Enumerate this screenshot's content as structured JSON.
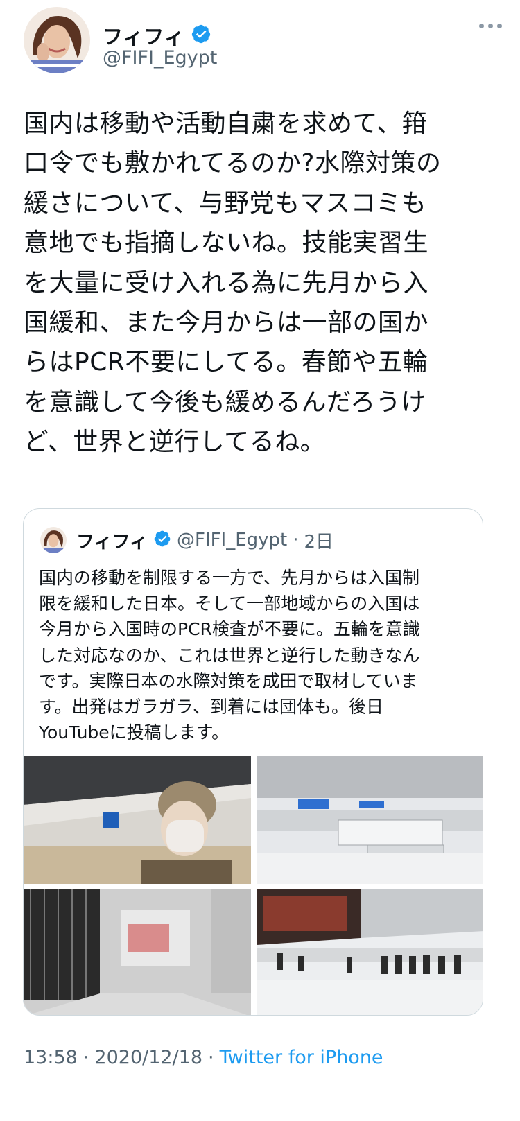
{
  "author": {
    "display_name": "フィフィ",
    "handle": "@FIFI_Egypt"
  },
  "tweet": {
    "text_lines": [
      "国内は移動や活動自粛を求めて、箝",
      "口令でも敷かれてるのか?水際対策の",
      "緩さについて、与野党もマスコミも",
      "意地でも指摘しないね。技能実習生",
      "を大量に受け入れる為に先月から入",
      "国緩和、また今月からは一部の国か",
      "らはPCR不要にしてる。春節や五輪",
      "を意識して今後も緩めるんだろうけ",
      "ど、世界と逆行してるね。"
    ]
  },
  "quoted_tweet": {
    "display_name": "フィフィ",
    "handle": "@FIFI_Egypt",
    "separator": "·",
    "age": "2日",
    "text_lines": [
      "国内の移動を制限する一方で、先月からは入国制",
      "限を緩和した日本。そして一部地域からの入国は",
      "今月から入国時のPCR検査が不要に。五輪を意識",
      "した対応なのか、これは世界と逆行した動きなん",
      "です。実際日本の水際対策を成田で取材していま",
      "す。出発はガラガラ、到着には団体も。後日",
      "YouTubeに投稿します。"
    ],
    "media": [
      "airport-selfie-photo",
      "departure-hall-photo",
      "closed-shops-corridor-photo",
      "arrival-hall-photo"
    ]
  },
  "meta": {
    "time": "13:58",
    "sep1": "·",
    "date": "2020/12/18",
    "sep2": "·",
    "source": "Twitter for iPhone"
  },
  "colors": {
    "accent": "#1d9bf0",
    "text": "#0f1419",
    "secondary": "#536471",
    "border": "#cfd9de"
  }
}
